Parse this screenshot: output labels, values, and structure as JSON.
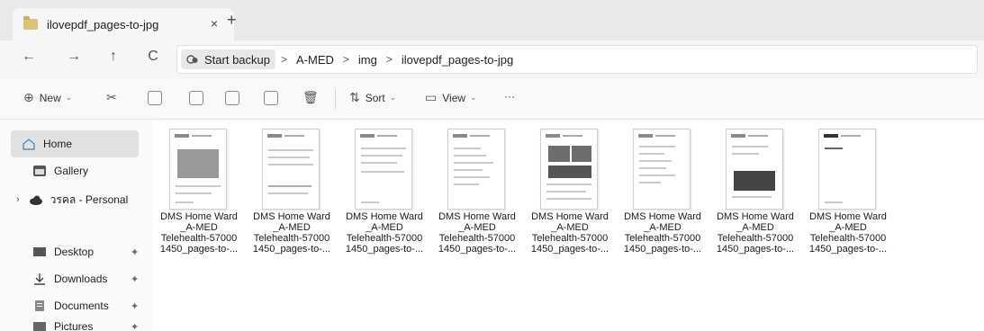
{
  "tab": {
    "title": "ilovepdf_pages-to-jpg",
    "close": "×",
    "new": "+"
  },
  "nav": {
    "back": "←",
    "forward": "→",
    "up": "↑",
    "refresh": "C"
  },
  "breadcrumb": {
    "chip_label": "Start backup",
    "items": [
      "A-MED",
      "img",
      "ilovepdf_pages-to-jpg"
    ],
    "separator": ">"
  },
  "toolbar": {
    "new_label": "New",
    "sort_label": "Sort",
    "view_label": "View",
    "more_label": "···"
  },
  "sidebar": {
    "home": "Home",
    "gallery": "Gallery",
    "personal": "วรคล - Personal",
    "desktop": "Desktop",
    "downloads": "Downloads",
    "documents": "Documents",
    "pictures": "Pictures"
  },
  "files": [
    {
      "line1": "DMS Home Ward",
      "line2": "_A-MED",
      "line3": "Telehealth-57000",
      "line4": "1450_pages-to-..."
    },
    {
      "line1": "DMS Home Ward",
      "line2": "_A-MED",
      "line3": "Telehealth-57000",
      "line4": "1450_pages-to-..."
    },
    {
      "line1": "DMS Home Ward",
      "line2": "_A-MED",
      "line3": "Telehealth-57000",
      "line4": "1450_pages-to-..."
    },
    {
      "line1": "DMS Home Ward",
      "line2": "_A-MED",
      "line3": "Telehealth-57000",
      "line4": "1450_pages-to-..."
    },
    {
      "line1": "DMS Home Ward",
      "line2": "_A-MED",
      "line3": "Telehealth-57000",
      "line4": "1450_pages-to-..."
    },
    {
      "line1": "DMS Home Ward",
      "line2": "_A-MED",
      "line3": "Telehealth-57000",
      "line4": "1450_pages-to-..."
    },
    {
      "line1": "DMS Home Ward",
      "line2": "_A-MED",
      "line3": "Telehealth-57000",
      "line4": "1450_pages-to-..."
    },
    {
      "line1": "DMS Home Ward",
      "line2": "_A-MED",
      "line3": "Telehealth-57000",
      "line4": "1450_pages-to-..."
    }
  ],
  "colors": {
    "accent": "#0067c0",
    "folder": "#d9c27a"
  }
}
